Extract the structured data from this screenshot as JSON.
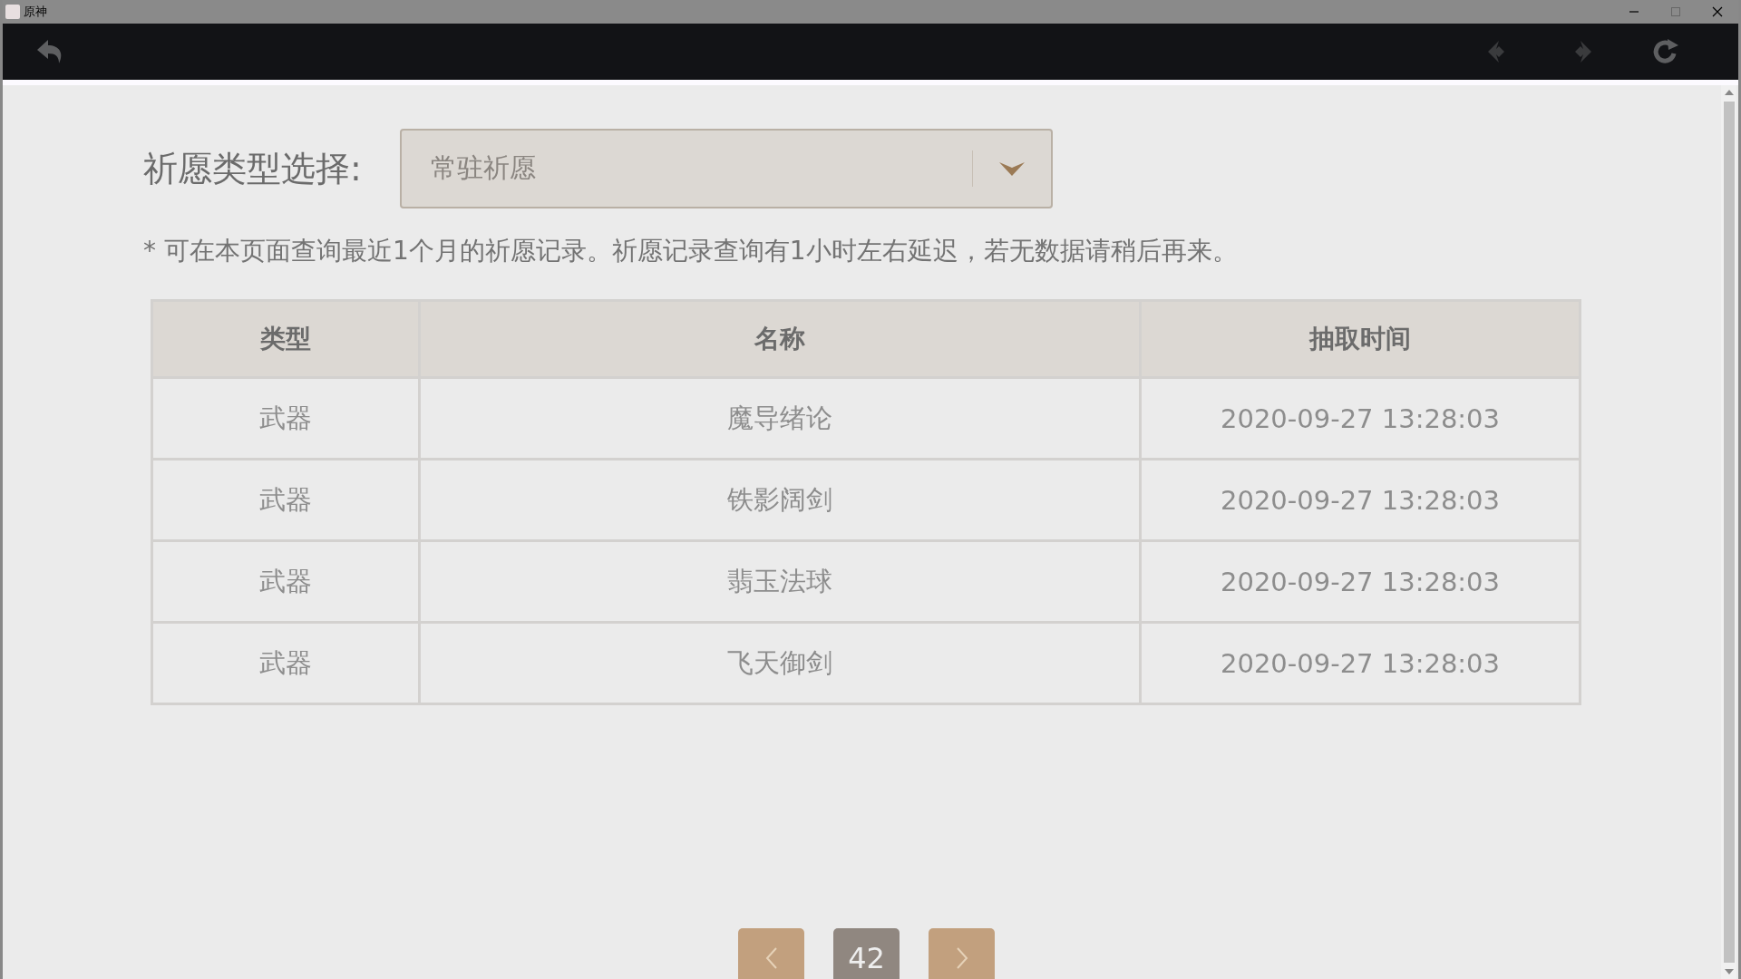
{
  "window": {
    "title": "原神"
  },
  "filter": {
    "label": "祈愿类型选择:",
    "value": "常驻祈愿"
  },
  "note": "* 可在本页面查询最近1个月的祈愿记录。祈愿记录查询有1小时左右延迟，若无数据请稍后再来。",
  "table": {
    "columns": [
      "类型",
      "名称",
      "抽取时间"
    ],
    "rows": [
      [
        "武器",
        "魔导绪论",
        "2020-09-27 13:28:03"
      ],
      [
        "武器",
        "铁影阔剑",
        "2020-09-27 13:28:03"
      ],
      [
        "武器",
        "翡玉法球",
        "2020-09-27 13:28:03"
      ],
      [
        "武器",
        "飞天御剑",
        "2020-09-27 13:28:03"
      ]
    ]
  },
  "pagination": {
    "page": "42"
  }
}
